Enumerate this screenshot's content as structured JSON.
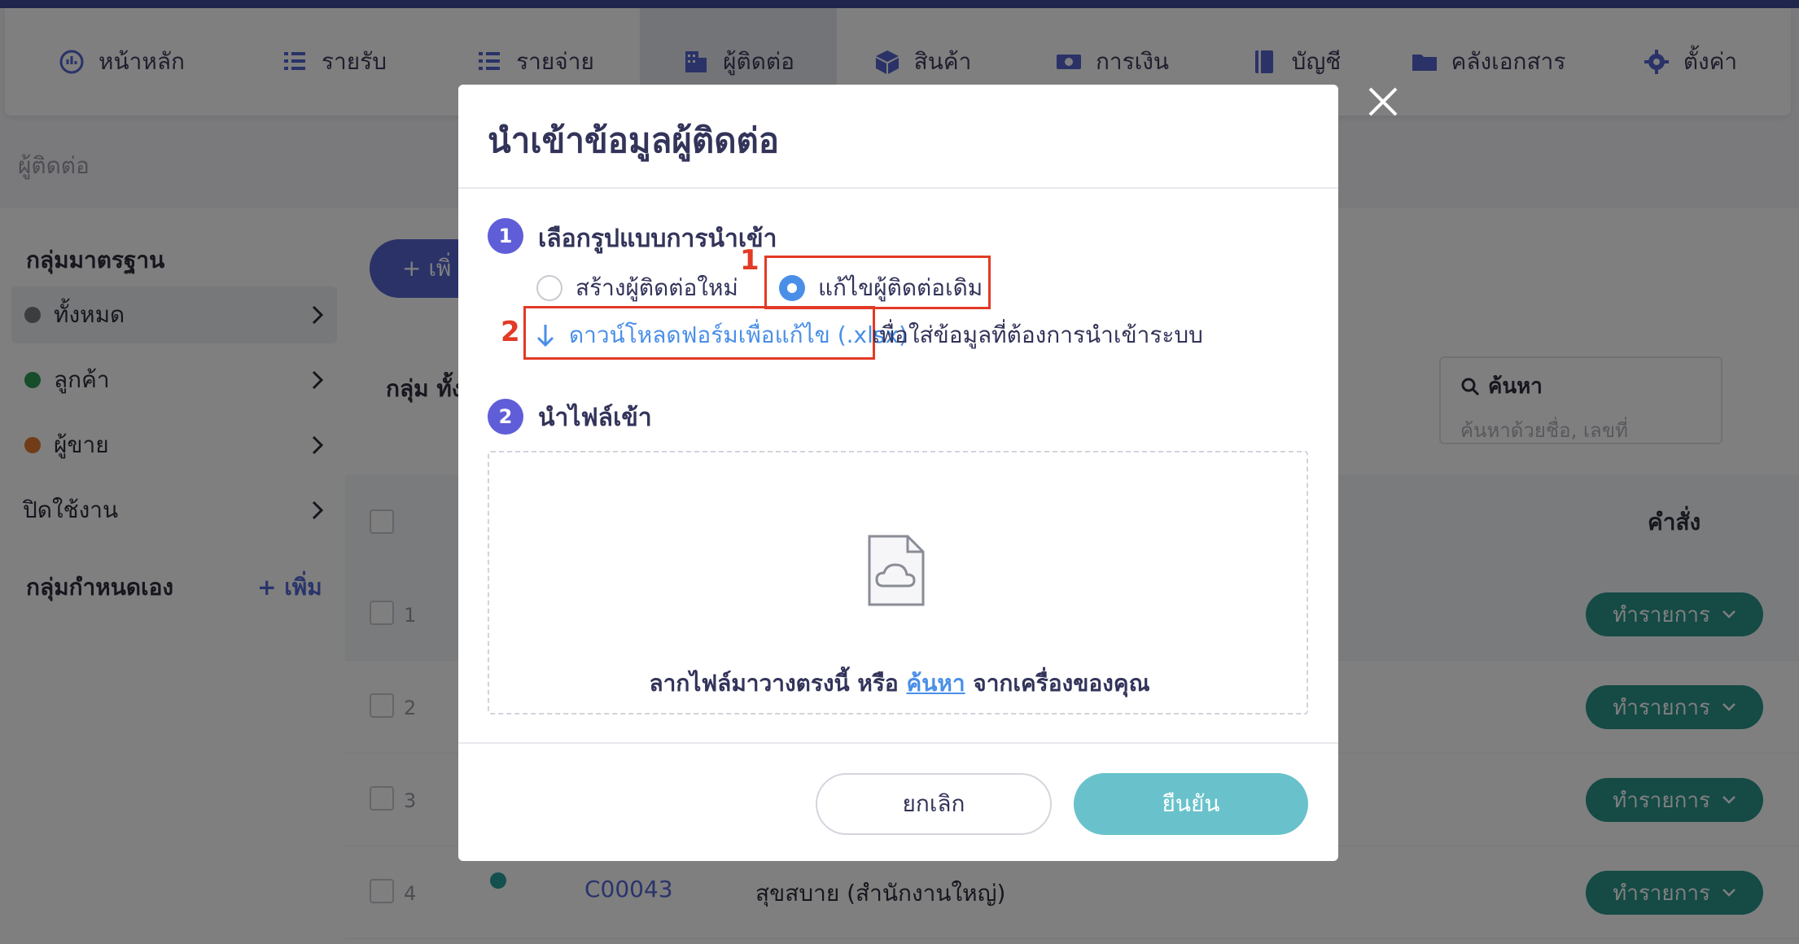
{
  "nav": {
    "items": [
      {
        "label": "หน้าหลัก",
        "icon": "dashboard-icon",
        "width": 286,
        "active": false
      },
      {
        "label": "รายรับ",
        "icon": "income-list-icon",
        "width": 236,
        "active": false
      },
      {
        "label": "รายจ่าย",
        "icon": "expense-list-icon",
        "width": 258,
        "active": false
      },
      {
        "label": "ผู้ติดต่อ",
        "icon": "building-icon",
        "width": 242,
        "active": true
      },
      {
        "label": "สินค้า",
        "icon": "box-icon",
        "width": 210,
        "active": false
      },
      {
        "label": "การเงิน",
        "icon": "money-icon",
        "width": 256,
        "active": false
      },
      {
        "label": "บัญชี",
        "icon": "ledger-icon",
        "width": 196,
        "active": false
      },
      {
        "label": "คลังเอกสาร",
        "icon": "folder-icon",
        "width": 276,
        "active": false
      },
      {
        "label": "ตั้งค่า",
        "icon": "gear-icon",
        "width": 220,
        "active": false
      }
    ]
  },
  "page": {
    "title": "ผู้ติดต่อ"
  },
  "sidebar": {
    "standard_heading": "กลุ่มมาตรฐาน",
    "items": [
      {
        "label": "ทั้งหมด",
        "dot": "#7a7a7a",
        "selected": true
      },
      {
        "label": "ลูกค้า",
        "dot": "#2e9a55",
        "selected": false
      },
      {
        "label": "ผู้ขาย",
        "dot": "#e07a2e",
        "selected": false
      },
      {
        "label": "ปิดใช้งาน",
        "dot": "",
        "selected": false
      }
    ],
    "custom_heading": "กลุ่มกำหนดเอง",
    "add_label": "+ เพิ่ม"
  },
  "main": {
    "add_button": "+ เพิ่",
    "filter_label": "กลุ่ม ทั้ง",
    "search_label": "ค้นหา",
    "search_placeholder": "ค้นหาด้วยชื่อ, เลขที่",
    "command_header": "คำสั่ง",
    "action_label": "ทำรายการ",
    "rows": [
      {
        "num": "1",
        "code": "",
        "name": ""
      },
      {
        "num": "2",
        "code": "",
        "name": ""
      },
      {
        "num": "3",
        "code": "",
        "name": ""
      },
      {
        "num": "4",
        "code": "C00043",
        "name": "สุขสบาย (สำนักงานใหญ่)"
      }
    ]
  },
  "modal": {
    "title": "นำเข้าข้อมูลผู้ติดต่อ",
    "step1": {
      "num": "1",
      "label": "เลือกรูปแบบการนำเข้า"
    },
    "option_new": "สร้างผู้ติดต่อใหม่",
    "option_edit": "แก้ไขผู้ติดต่อเดิม",
    "selected_option": "แก้ไขผู้ติดต่อเดิม",
    "annotation_1": "1",
    "annotation_2": "2",
    "download_link": "ดาวน์โหลดฟอร์มเพื่อแก้ไข (.xlsx)",
    "download_suffix": "เพื่อใส่ข้อมูลที่ต้องการนำเข้าระบบ",
    "step2": {
      "num": "2",
      "label": "นำไฟล์เข้า"
    },
    "drop_text_before": "ลากไฟล์มาวางตรงนี้ หรือ ",
    "drop_link": "ค้นหา",
    "drop_text_after": " จากเครื่องของคุณ",
    "cancel": "ยกเลิก",
    "confirm": "ยืนยัน"
  },
  "colors": {
    "primary": "#5564d0",
    "step_circle": "#5f5ed8",
    "link": "#4a8fe7",
    "annotation_red": "#e23a26",
    "confirm_button": "#69c2cb",
    "action_button": "#2b958a"
  }
}
